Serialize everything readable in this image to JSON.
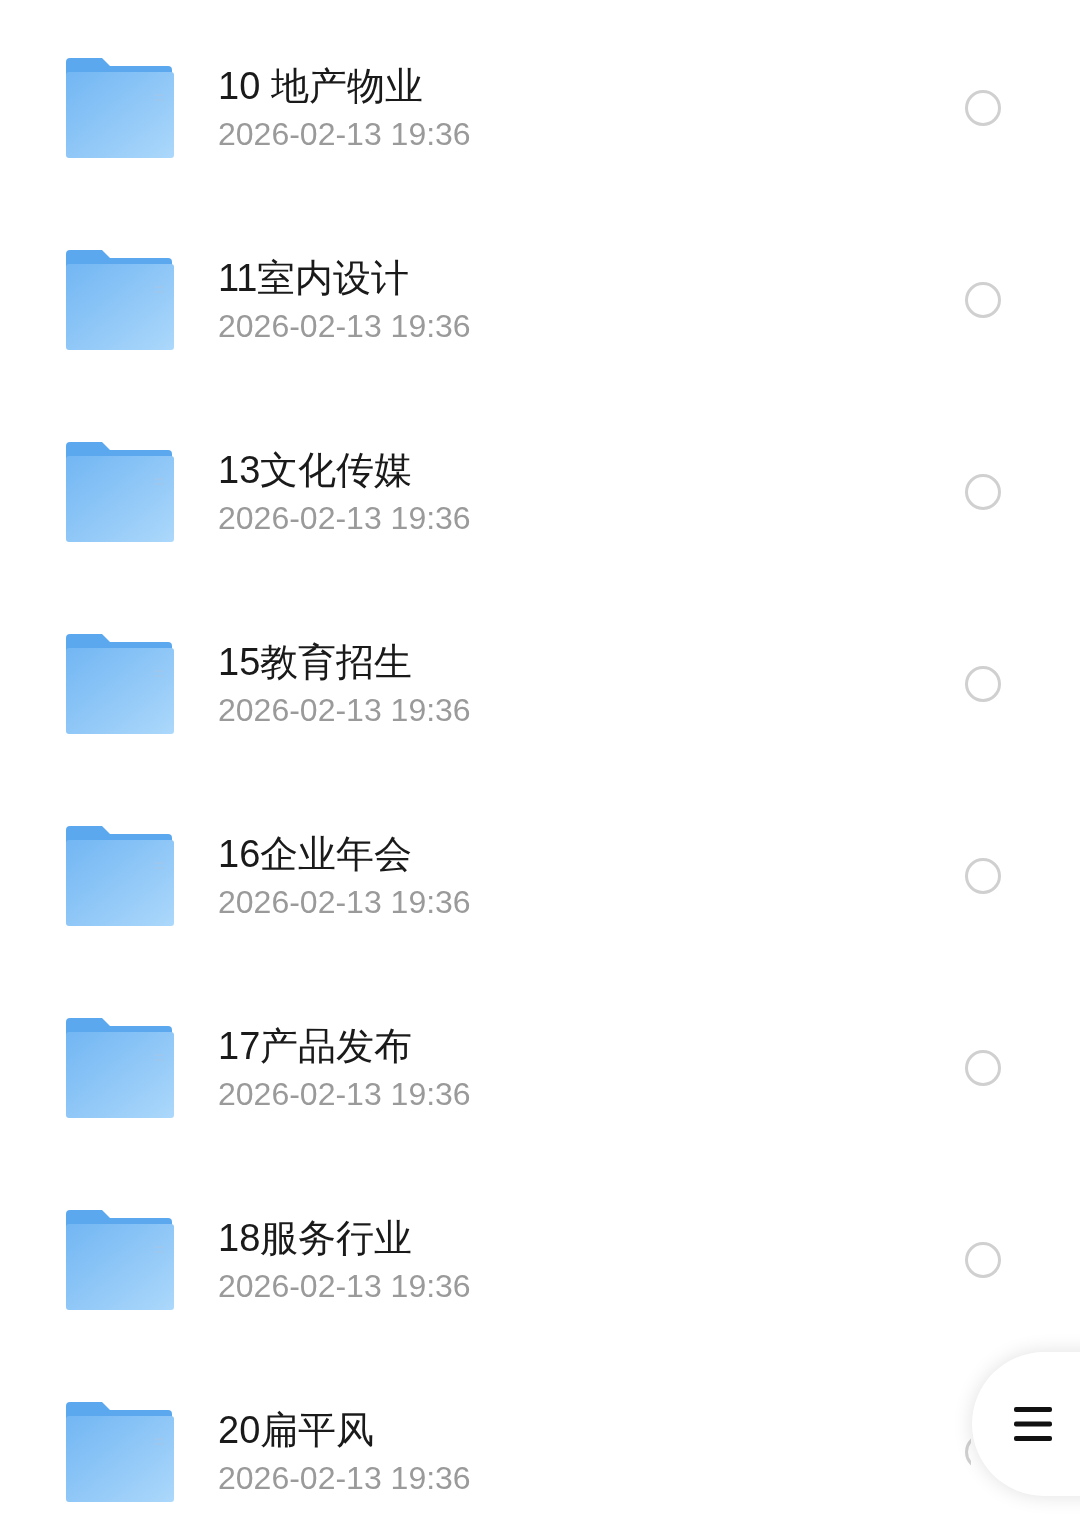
{
  "files": [
    {
      "name": "10 地产物业",
      "date": "2026-02-13 19:36",
      "selected": false
    },
    {
      "name": "11室内设计",
      "date": "2026-02-13 19:36",
      "selected": false
    },
    {
      "name": "13文化传媒",
      "date": "2026-02-13 19:36",
      "selected": false
    },
    {
      "name": "15教育招生",
      "date": "2026-02-13 19:36",
      "selected": false
    },
    {
      "name": "16企业年会",
      "date": "2026-02-13 19:36",
      "selected": false
    },
    {
      "name": "17产品发布",
      "date": "2026-02-13 19:36",
      "selected": false
    },
    {
      "name": "18服务行业",
      "date": "2026-02-13 19:36",
      "selected": false
    },
    {
      "name": "20扁平风",
      "date": "2026-02-13 19:36",
      "selected": false
    }
  ]
}
